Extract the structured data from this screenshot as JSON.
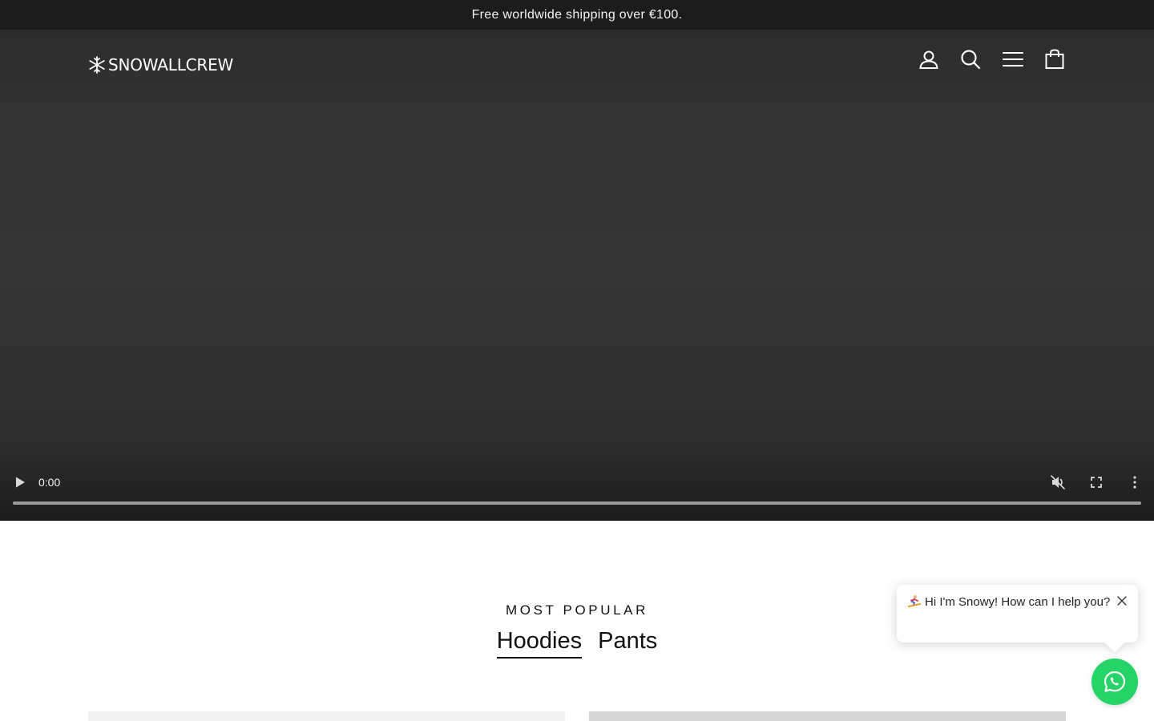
{
  "announcement": {
    "text": "Free worldwide shipping over €100."
  },
  "header": {
    "logo_text": "SNOWALLCREW",
    "icons": {
      "account": "account-icon",
      "search": "search-icon",
      "menu": "hamburger-menu-icon",
      "cart": "cart-icon"
    }
  },
  "video": {
    "current_time": "0:00",
    "progress": 0,
    "muted": true,
    "icons": {
      "play": "play-icon",
      "mute": "muted-icon",
      "fullscreen": "fullscreen-icon",
      "more": "more-options-icon"
    }
  },
  "section": {
    "eyebrow": "MOST POPULAR",
    "tabs": [
      {
        "label": "Hoodies",
        "active": true
      },
      {
        "label": "Pants",
        "active": false
      }
    ]
  },
  "chat": {
    "message": "Hi I'm Snowy! How can I help you?",
    "icons": {
      "emoji": "snowboarder-icon",
      "close": "close-icon",
      "launcher": "whatsapp-icon"
    },
    "launcher_color": "#25d366"
  },
  "colors": {
    "announcement_bg": "#1c1c1c",
    "hero_bg": "#333333",
    "text": "#111111"
  }
}
